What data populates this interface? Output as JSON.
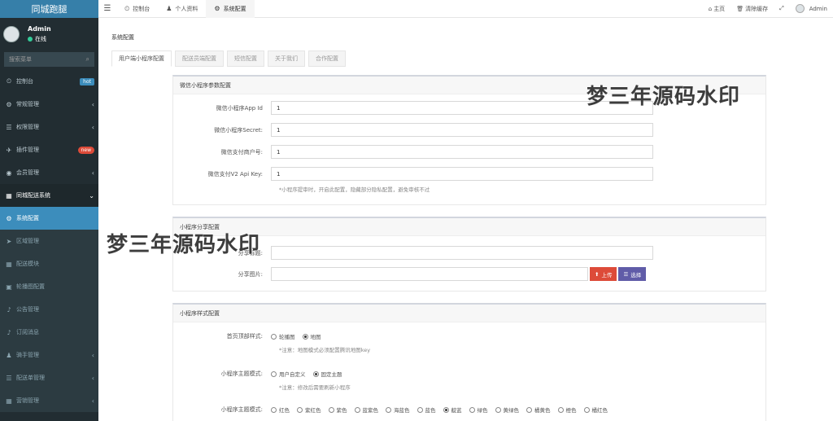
{
  "sidebar": {
    "logo": "同城跑腿",
    "user": {
      "name": "Admin",
      "status": "在线"
    },
    "search_placeholder": "搜索菜单",
    "items": [
      {
        "icon": "⏲",
        "label": "控制台",
        "badge": "hot",
        "state": "normal"
      },
      {
        "icon": "⚙",
        "label": "常规管理",
        "arrow": "‹",
        "state": "normal"
      },
      {
        "icon": "☰",
        "label": "权限管理",
        "arrow": "‹",
        "state": "normal"
      },
      {
        "icon": "✈",
        "label": "插件管理",
        "badge": "new",
        "state": "normal"
      },
      {
        "icon": "◉",
        "label": "会员管理",
        "arrow": "‹",
        "state": "normal"
      },
      {
        "icon": "▦",
        "label": "同城配送系统",
        "arrow": "⌄",
        "state": "open"
      },
      {
        "icon": "⚙",
        "label": "系统配置",
        "state": "active"
      },
      {
        "icon": "➤",
        "label": "区域管理",
        "state": "sub"
      },
      {
        "icon": "▦",
        "label": "配送模块",
        "state": "sub"
      },
      {
        "icon": "▣",
        "label": "轮播图配置",
        "state": "sub"
      },
      {
        "icon": "♪",
        "label": "公告管理",
        "state": "sub"
      },
      {
        "icon": "♪",
        "label": "订阅消息",
        "state": "sub"
      },
      {
        "icon": "♟",
        "label": "骑手管理",
        "arrow": "‹",
        "state": "sub"
      },
      {
        "icon": "☰",
        "label": "配送单管理",
        "arrow": "‹",
        "state": "sub"
      },
      {
        "icon": "▦",
        "label": "营销管理",
        "arrow": "‹",
        "state": "sub"
      }
    ]
  },
  "topbar": {
    "tabs": [
      {
        "icon": "⏲",
        "label": "控制台",
        "active": false
      },
      {
        "icon": "♟",
        "label": "个人资料",
        "active": false
      },
      {
        "icon": "⚙",
        "label": "系统配置",
        "active": true
      }
    ],
    "home": "主页",
    "clear_cache": "清除缓存",
    "fullscreen_icon": "⤢",
    "user": "Admin"
  },
  "main": {
    "title": "系统配置",
    "tabs": [
      "用户端小程序配置",
      "配送员端配置",
      "短信配置",
      "关于我们",
      "合作配置"
    ],
    "section1": {
      "title": "微信小程序参数配置",
      "fields": [
        {
          "label": "微信小程序App Id",
          "value": "1"
        },
        {
          "label": "微信小程序Secret:",
          "value": "1"
        },
        {
          "label": "微信支付商户号:",
          "value": "1"
        },
        {
          "label": "微信支付V2 Api Key:",
          "value": "1"
        }
      ],
      "hint": "*小程序提审时，开启此配置，隐藏部分隐私配置，避免审核不过"
    },
    "section2": {
      "title": "小程序分享配置",
      "share_title_label": "分享标题:",
      "share_title_value": "",
      "share_image_label": "分享图片:",
      "share_image_value": "",
      "upload_label": "上传",
      "choose_label": "选择"
    },
    "section3": {
      "title": "小程序样式配置",
      "home_top_label": "首页顶部样式:",
      "home_top_options": [
        {
          "label": "轮播图",
          "checked": false
        },
        {
          "label": "地图",
          "checked": true
        }
      ],
      "home_top_hint": "*注意：地图模式必须配置腾讯地图key",
      "theme_mode_label": "小程序主题模式:",
      "theme_mode_options": [
        {
          "label": "用户自定义",
          "checked": false
        },
        {
          "label": "固定主题",
          "checked": true
        }
      ],
      "theme_mode_hint": "*注意：修改后需要刷新小程序",
      "theme_color_label": "小程序主题模式:",
      "theme_colors": [
        {
          "label": "红色",
          "checked": false
        },
        {
          "label": "紫红色",
          "checked": false
        },
        {
          "label": "紫色",
          "checked": false
        },
        {
          "label": "蓝紫色",
          "checked": false
        },
        {
          "label": "海蓝色",
          "checked": false
        },
        {
          "label": "蓝色",
          "checked": false
        },
        {
          "label": "靛蓝",
          "checked": true
        },
        {
          "label": "绿色",
          "checked": false
        },
        {
          "label": "黄绿色",
          "checked": false
        },
        {
          "label": "橘黄色",
          "checked": false
        },
        {
          "label": "橙色",
          "checked": false
        },
        {
          "label": "橘红色",
          "checked": false
        }
      ]
    }
  },
  "watermarks": [
    "梦三年源码水印",
    "梦三年源码水印"
  ]
}
